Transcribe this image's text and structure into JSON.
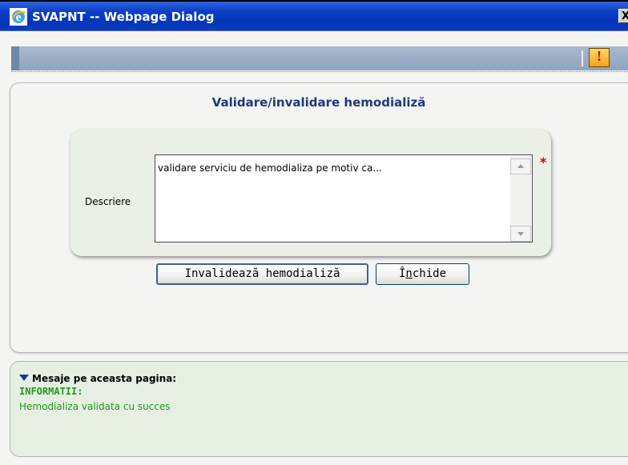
{
  "window": {
    "title": "SVAPNT -- Webpage Dialog",
    "close_label": "X"
  },
  "toolbar": {
    "alert_label": "!"
  },
  "form": {
    "title": "Validare/invalidare hemodializă",
    "description_label": "Descriere",
    "description_value": "validare serviciu de hemodializa pe motiv ca...",
    "required_marker": "*"
  },
  "buttons": {
    "invalidate_label": "Invalidează hemodializă",
    "close_label_pre": "Î",
    "close_label_hotkey": "n",
    "close_label_post": "chide"
  },
  "messages": {
    "header": "Mesaje pe aceasta pagina:",
    "info_title": "INFORMATII:",
    "info_text": "Hemodializa validata cu succes"
  },
  "colors": {
    "titlebar": "#0535b8",
    "panel_title": "#1f3a78",
    "info_text": "#1c9a1c",
    "required": "#d00000"
  }
}
